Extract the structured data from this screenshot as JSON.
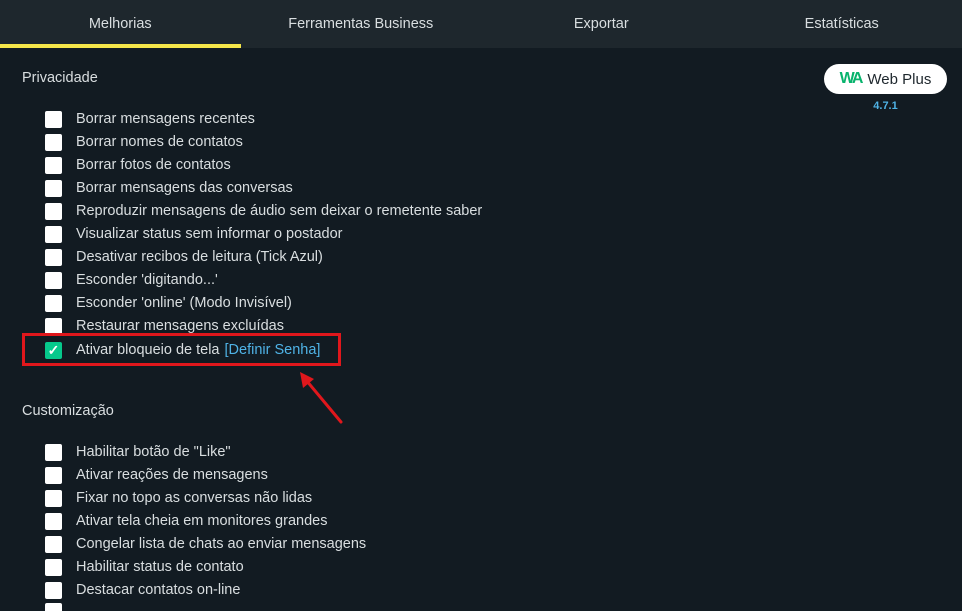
{
  "tabs": [
    {
      "label": "Melhorias",
      "active": true
    },
    {
      "label": "Ferramentas Business",
      "active": false
    },
    {
      "label": "Exportar",
      "active": false
    },
    {
      "label": "Estatísticas",
      "active": false
    }
  ],
  "brand": {
    "name": "Web Plus",
    "mark": "WA",
    "version": "4.7.1"
  },
  "privacy": {
    "title": "Privacidade",
    "options": [
      {
        "label": "Borrar mensagens recentes",
        "checked": false
      },
      {
        "label": "Borrar nomes de contatos",
        "checked": false
      },
      {
        "label": "Borrar fotos de contatos",
        "checked": false
      },
      {
        "label": "Borrar mensagens das conversas",
        "checked": false
      },
      {
        "label": "Reproduzir mensagens de áudio sem deixar o remetente saber",
        "checked": false
      },
      {
        "label": "Visualizar status sem informar o postador",
        "checked": false
      },
      {
        "label": "Desativar recibos de leitura (Tick Azul)",
        "checked": false
      },
      {
        "label": "Esconder 'digitando...'",
        "checked": false
      },
      {
        "label": "Esconder 'online' (Modo Invisível)",
        "checked": false
      },
      {
        "label": "Restaurar mensagens excluídas",
        "checked": false
      },
      {
        "label": "Ativar bloqueio de tela",
        "checked": true,
        "link": "[Definir Senha]"
      }
    ]
  },
  "customization": {
    "title": "Customização",
    "options": [
      {
        "label": "Habilitar botão de \"Like\"",
        "checked": false
      },
      {
        "label": "Ativar reações de mensagens",
        "checked": false
      },
      {
        "label": "Fixar no topo as conversas não lidas",
        "checked": false
      },
      {
        "label": "Ativar tela cheia em monitores grandes",
        "checked": false
      },
      {
        "label": "Congelar lista de chats ao enviar mensagens",
        "checked": false
      },
      {
        "label": "Habilitar status de contato",
        "checked": false
      },
      {
        "label": "Destacar contatos on-line",
        "checked": false
      }
    ]
  },
  "colors": {
    "accent_tab": "#f5e64a",
    "checkbox_on": "#06c98c",
    "link": "#4fb3e6",
    "highlight": "#e0171c"
  }
}
